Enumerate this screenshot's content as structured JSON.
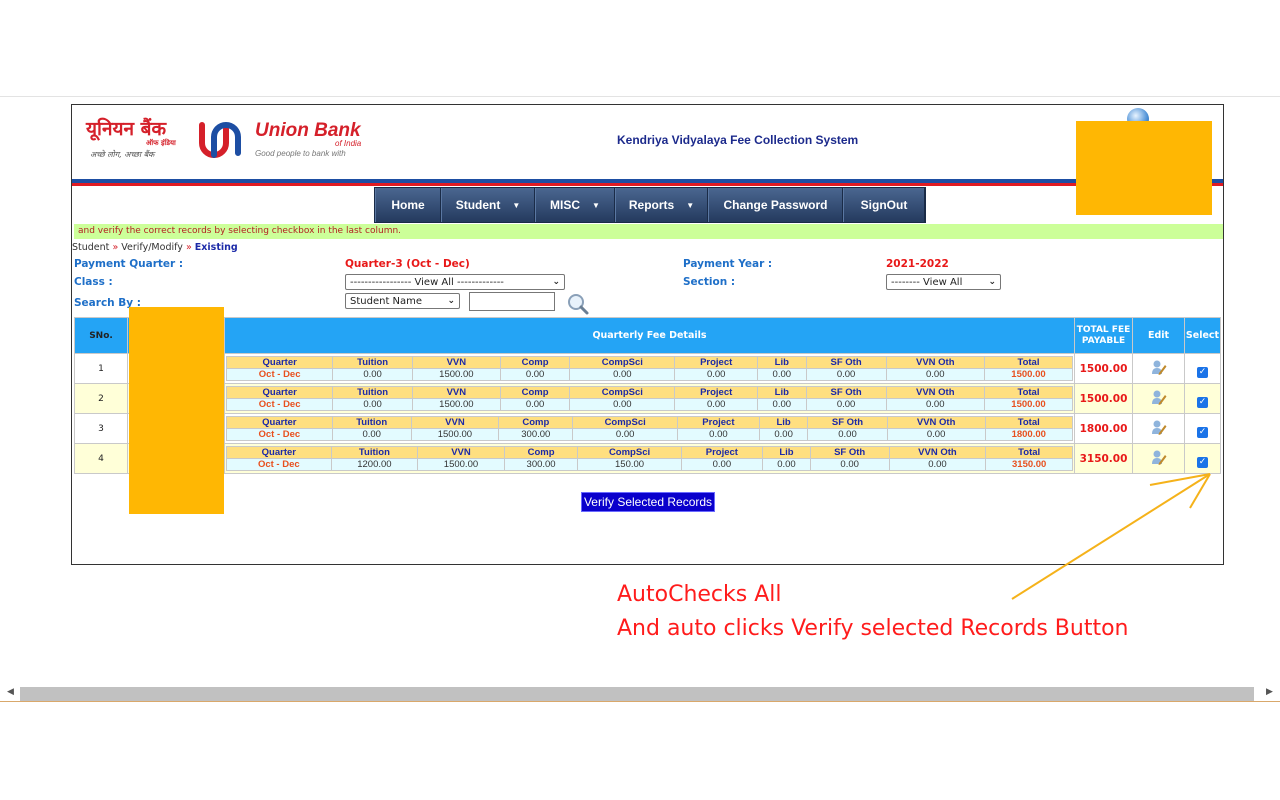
{
  "header": {
    "logo_hindi": "यूनियन बैंक",
    "logo_hindi_sub": "ऑफ इंडिया",
    "logo_hindi_tagline": "अच्छे लोग, अच्छा बैंक",
    "logo_en": "Union Bank",
    "logo_en_sub": "of India",
    "logo_en_tagline": "Good people to bank with",
    "system_title": "Kendriya Vidyalaya Fee Collection System"
  },
  "nav": {
    "items": [
      {
        "label": "Home",
        "dropdown": false
      },
      {
        "label": "Student",
        "dropdown": true
      },
      {
        "label": "MISC",
        "dropdown": true
      },
      {
        "label": "Reports",
        "dropdown": true
      },
      {
        "label": "Change Password",
        "dropdown": false
      },
      {
        "label": "SignOut",
        "dropdown": false
      }
    ],
    "caret": "▼"
  },
  "notice": "and verify the correct records by selecting checkbox in the last column.",
  "breadcrumb": {
    "items": [
      "Student",
      "Verify/Modify",
      "Existing"
    ],
    "separator": "»"
  },
  "form": {
    "payment_quarter_label": "Payment Quarter :",
    "payment_quarter_value": "Quarter-3 (Oct - Dec)",
    "payment_year_label": "Payment Year :",
    "payment_year_value": "2021-2022",
    "class_label": "Class :",
    "class_select": "----------------- View All -------------",
    "section_label": "Section :",
    "section_select": "-------- View All",
    "search_by_label": "Search By :",
    "search_by_select": "Student Name",
    "search_input_value": "",
    "chevron": "⌄"
  },
  "table": {
    "headers": {
      "sno": "SNo.",
      "details": "Quarterly Fee Details",
      "total": "TOTAL FEE PAYABLE",
      "edit": "Edit",
      "select": "Select"
    },
    "inner_headers": [
      "Quarter",
      "Tuition",
      "VVN",
      "Comp",
      "CompSci",
      "Project",
      "Lib",
      "SF Oth",
      "VVN Oth",
      "Total"
    ],
    "rows": [
      {
        "sno": "1",
        "values": [
          "Oct - Dec",
          "0.00",
          "1500.00",
          "0.00",
          "0.00",
          "0.00",
          "0.00",
          "0.00",
          "0.00",
          "1500.00"
        ],
        "total_payable": "1500.00",
        "selected": true
      },
      {
        "sno": "2",
        "values": [
          "Oct - Dec",
          "0.00",
          "1500.00",
          "0.00",
          "0.00",
          "0.00",
          "0.00",
          "0.00",
          "0.00",
          "1500.00"
        ],
        "total_payable": "1500.00",
        "selected": true
      },
      {
        "sno": "3",
        "values": [
          "Oct - Dec",
          "0.00",
          "1500.00",
          "300.00",
          "0.00",
          "0.00",
          "0.00",
          "0.00",
          "0.00",
          "1800.00"
        ],
        "total_payable": "1800.00",
        "selected": true
      },
      {
        "sno": "4",
        "values": [
          "Oct - Dec",
          "1200.00",
          "1500.00",
          "300.00",
          "150.00",
          "0.00",
          "0.00",
          "0.00",
          "0.00",
          "3150.00"
        ],
        "total_payable": "3150.00",
        "selected": true
      }
    ]
  },
  "verify_button": "Verify Selected Records",
  "annotation": {
    "line1": "AutoChecks All",
    "line2": "And auto clicks Verify selected Records Button"
  },
  "colors": {
    "header_blue": "#24a4f5",
    "redaction": "#ffb703",
    "annotation_red": "#ff1c1c",
    "arrow": "#f5b21a"
  }
}
